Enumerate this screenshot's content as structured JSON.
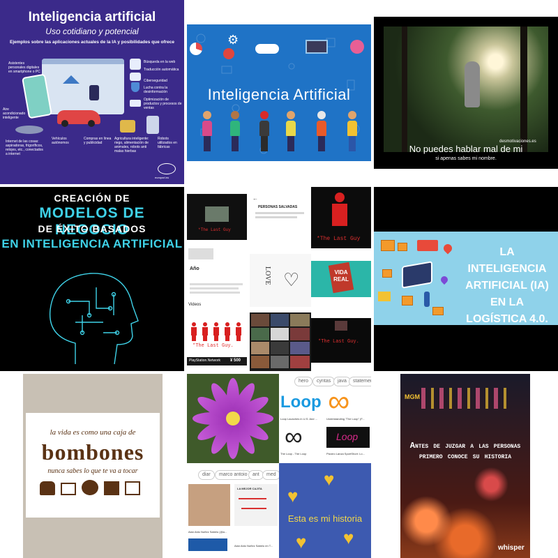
{
  "tile1": {
    "title": "Inteligencia artificial",
    "subtitle": "Uso cotidiano y potencial",
    "heading": "Ejemplos sobre las aplicaciones actuales de la IA y posibilidades que ofrece",
    "labels": {
      "asistentes": "Asistentes personales digitales en smartphone o PC",
      "busqueda": "Búsqueda en la web",
      "traduccion": "Traducción automática",
      "ciber": "Ciberseguridad",
      "desinfo": "Lucha contra la desinformación",
      "optimizacion": "Optimización de productos y procesos de ventas",
      "aire": "Aire acondicionado inteligente",
      "internet": "Internet de las cosas: aspiradoras, frigoríficos, relojes, etc., conectados a internet",
      "vehiculos": "Vehículos autónomos",
      "compras": "Compras en línea y publicidad",
      "agricultura": "Agricultura inteligente: riego, alimentación de animales, robots anti malas hierbas",
      "robots": "Robots utilizados en fábricas"
    },
    "footer": "europarl.eu",
    "colors": {
      "bg": "#3b2a8a",
      "panel": "#d9e4f2",
      "car": "#e04545"
    }
  },
  "tile2": {
    "title": "Inteligencia Artificial",
    "colors": {
      "bg": "#1f73c6"
    }
  },
  "tile3": {
    "watermark": "desmotivaciones.es",
    "caption": "No puedes hablar mal de mi",
    "sub": "si apenas sabes mi nombre."
  },
  "tile4": {
    "line1": "CREACIÓN DE",
    "line2": "MODELOS DE NEGOCIO",
    "line3": "DE ÉXITO BASADOS",
    "line4": "EN INTELIGENCIA ARTIFICIAL",
    "colors": {
      "accent": "#3fd2e8",
      "bg": "#000000"
    }
  },
  "tile5": {
    "lastguy": "*The Last Guy",
    "lastguy2": "*The Last Guy.",
    "personas": "PERSONAS SALVADAS",
    "anio": "Año",
    "videos": "Videos",
    "psn": "PlayStation.Network",
    "price": "¥ 500",
    "vida": "VIDA",
    "real": "REAL",
    "love": "LOVE"
  },
  "tile6": {
    "text": "LA INTELIGENCIA ARTIFICIAL (IA) EN LA LOGÍSTICA 4.0.",
    "colors": {
      "bg": "#8fd2ea"
    }
  },
  "tile7": {
    "line1": "la vida es como una caja de",
    "line2": "bombones",
    "line3": "nunca sabes lo que te va a tocar",
    "colors": {
      "brown": "#5a3214",
      "bg": "#c8c0b4"
    }
  },
  "tile8": {
    "loop_logo": "Loop",
    "caption1": "Loop Launches in U.S. And ...",
    "caption2": "Understanding \"The Loop\" (F...",
    "caption3": "The Loop - The Loop",
    "caption4": "Pizarro Lanza SportShort: Lo...",
    "loop_word": "Loop",
    "chips_top": [
      "hero",
      "cyntas",
      "java",
      "statement"
    ],
    "chips_bottom": [
      "diar",
      "marco antoio",
      "ant",
      "med"
    ],
    "bubble": "LA MEJOR CAJITA",
    "caption5": "Alan Aldo Nuñez Sabelo (@a...",
    "caption6": "Alan Aldo Nuñez Sabelo en T...",
    "story": "Esta es mi historia",
    "colors": {
      "story_bg": "#3d5ab0",
      "heart": "#f2c233"
    }
  },
  "tile9": {
    "text": "Antes de juzgar a las personas primero conoce su historia",
    "brand": "whisper",
    "sign": "MGM"
  }
}
